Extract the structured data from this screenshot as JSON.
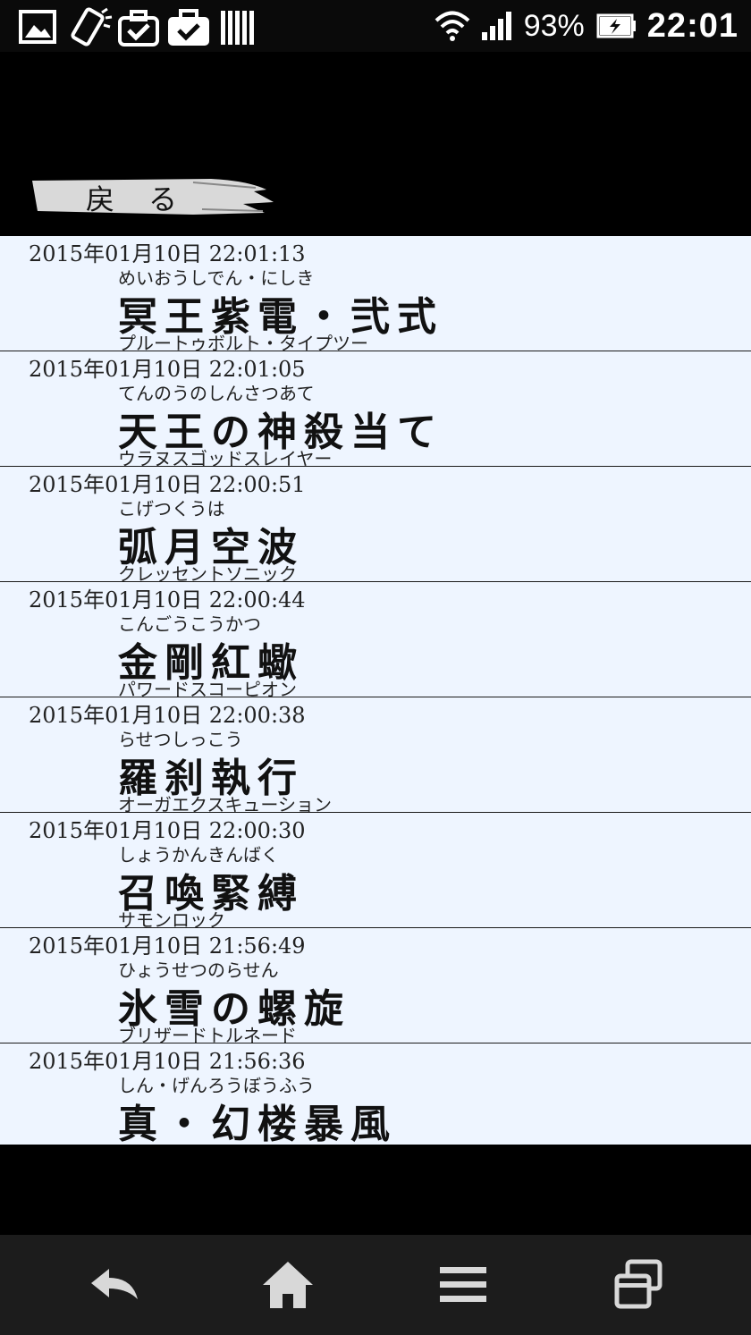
{
  "status_bar": {
    "left_icons": [
      "gallery-icon",
      "screen-rotation-icon",
      "task-check-icon",
      "briefcase-check-icon",
      "barcode-icon"
    ],
    "battery": "93%",
    "time": "22:01"
  },
  "header": {
    "back_label": "戻る"
  },
  "history": [
    {
      "date": "2015年01月10日  22:01:13",
      "reading": "めいおうしでん・にしき",
      "name": "冥王紫電・弐式",
      "english": "プルートゥボルト・タイプツー"
    },
    {
      "date": "2015年01月10日  22:01:05",
      "reading": "てんのうのしんさつあて",
      "name": "天王の神殺当て",
      "english": "ウラヌスゴッドスレイヤー"
    },
    {
      "date": "2015年01月10日  22:00:51",
      "reading": "こげつくうは",
      "name": "弧月空波",
      "english": "クレッセントソニック"
    },
    {
      "date": "2015年01月10日  22:00:44",
      "reading": "こんごうこうかつ",
      "name": "金剛紅蠍",
      "english": "パワードスコーピオン"
    },
    {
      "date": "2015年01月10日  22:00:38",
      "reading": "らせつしっこう",
      "name": "羅刹執行",
      "english": "オーガエクスキューション"
    },
    {
      "date": "2015年01月10日  22:00:30",
      "reading": "しょうかんきんばく",
      "name": "召喚緊縛",
      "english": "サモンロック"
    },
    {
      "date": "2015年01月10日  21:56:49",
      "reading": "ひょうせつのらせん",
      "name": "氷雪の螺旋",
      "english": "ブリザードトルネード"
    },
    {
      "date": "2015年01月10日  21:56:36",
      "reading": "しん・げんろうぼうふう",
      "name": "真・幻楼暴風",
      "english": ""
    }
  ],
  "nav_bar": {
    "buttons": [
      "back-icon",
      "home-icon",
      "menu-icon",
      "recent-apps-icon"
    ]
  }
}
